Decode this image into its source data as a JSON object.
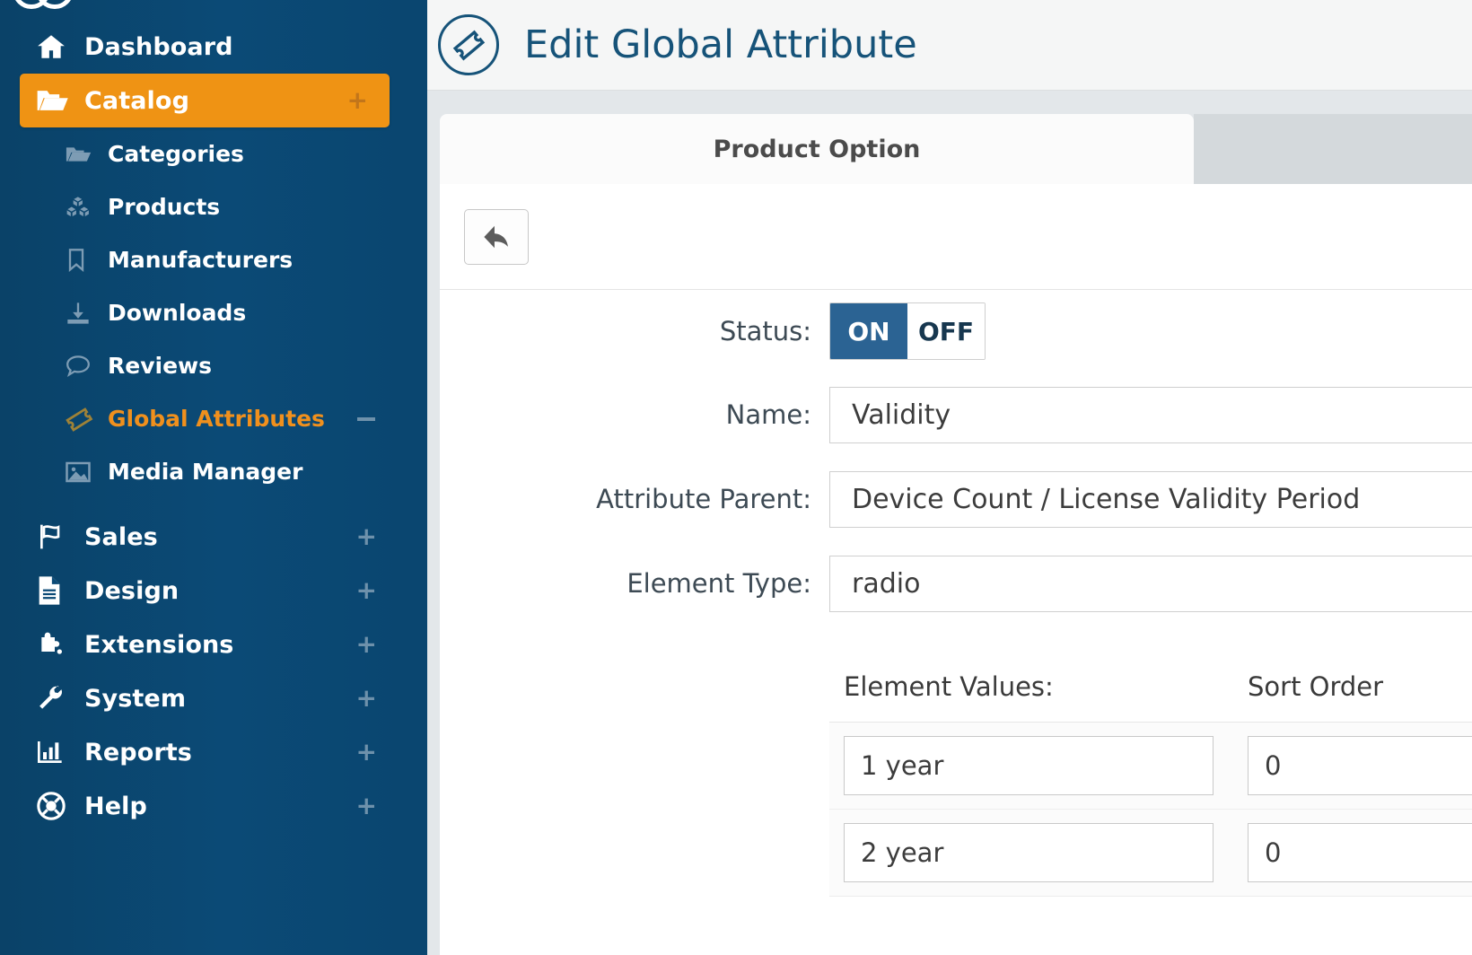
{
  "sidebar": {
    "logo_icon": "double-circle-logo",
    "items": [
      {
        "label": "Dashboard",
        "icon": "home-icon",
        "type": "top",
        "active": false,
        "expander": ""
      },
      {
        "label": "Catalog",
        "icon": "folder-open-icon",
        "type": "top",
        "active": true,
        "expander": "+"
      },
      {
        "label": "Categories",
        "icon": "folder-open-icon",
        "type": "sub",
        "active": false,
        "expander": ""
      },
      {
        "label": "Products",
        "icon": "boxes-icon",
        "type": "sub",
        "active": false,
        "expander": ""
      },
      {
        "label": "Manufacturers",
        "icon": "bookmark-icon",
        "type": "sub",
        "active": false,
        "expander": ""
      },
      {
        "label": "Downloads",
        "icon": "download-icon",
        "type": "sub",
        "active": false,
        "expander": ""
      },
      {
        "label": "Reviews",
        "icon": "comment-icon",
        "type": "sub",
        "active": false,
        "expander": ""
      },
      {
        "label": "Global Attributes",
        "icon": "ticket-icon",
        "type": "sub",
        "active": true,
        "expander": "-"
      },
      {
        "label": "Media Manager",
        "icon": "image-icon",
        "type": "sub",
        "active": false,
        "expander": ""
      },
      {
        "label": "Sales",
        "icon": "flag-icon",
        "type": "top",
        "active": false,
        "expander": "+"
      },
      {
        "label": "Design",
        "icon": "document-icon",
        "type": "top",
        "active": false,
        "expander": "+"
      },
      {
        "label": "Extensions",
        "icon": "puzzle-icon",
        "type": "top",
        "active": false,
        "expander": "+"
      },
      {
        "label": "System",
        "icon": "wrench-icon",
        "type": "top",
        "active": false,
        "expander": "+"
      },
      {
        "label": "Reports",
        "icon": "bar-chart-icon",
        "type": "top",
        "active": false,
        "expander": "+"
      },
      {
        "label": "Help",
        "icon": "lifebuoy-icon",
        "type": "top",
        "active": false,
        "expander": "+"
      }
    ],
    "colors": {
      "background": "#0b4a76",
      "active_background": "#ef9314",
      "active_link_text": "#f0901d"
    }
  },
  "header": {
    "title": "Edit Global Attribute",
    "icon": "ticket-circle-icon",
    "color": "#165379"
  },
  "tabs": [
    {
      "label": "Product Option",
      "active": true
    }
  ],
  "toolbar": {
    "back_icon": "arrow-left-icon",
    "back_label": ""
  },
  "form": {
    "status": {
      "label": "Status:",
      "on_label": "ON",
      "off_label": "OFF",
      "value": "ON",
      "on_color": "#2b6393"
    },
    "fields": [
      {
        "label": "Name:",
        "value": "Validity"
      },
      {
        "label": "Attribute Parent:",
        "value": "Device Count / License Validity Period"
      },
      {
        "label": "Element Type:",
        "value": "radio"
      }
    ]
  },
  "element_values": {
    "headers": [
      "Element Values:",
      "Sort Order"
    ],
    "rows": [
      {
        "value": "1 year",
        "sort_order": "0"
      },
      {
        "value": "2 year",
        "sort_order": "0"
      }
    ]
  }
}
